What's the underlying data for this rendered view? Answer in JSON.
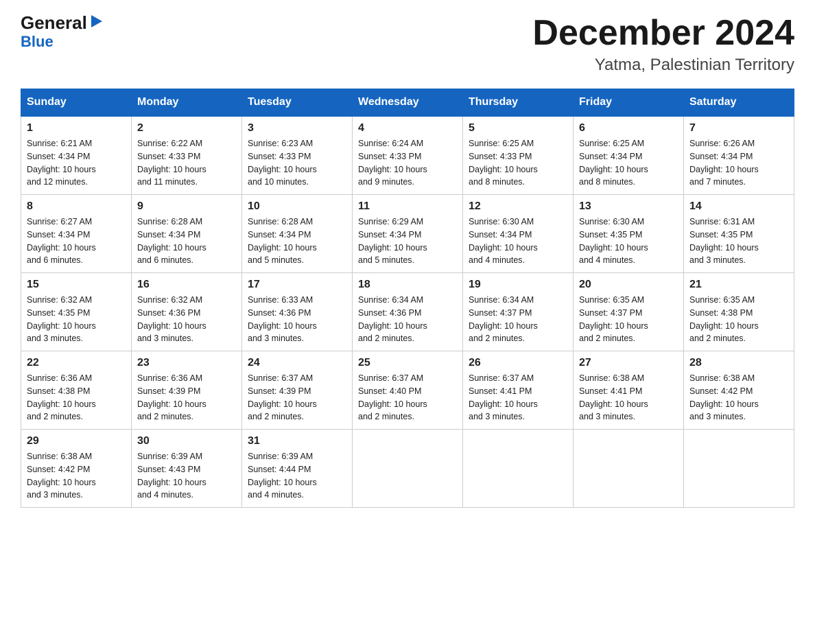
{
  "logo": {
    "general": "General",
    "blue": "Blue",
    "triangle": "▶"
  },
  "title": "December 2024",
  "subtitle": "Yatma, Palestinian Territory",
  "headers": [
    "Sunday",
    "Monday",
    "Tuesday",
    "Wednesday",
    "Thursday",
    "Friday",
    "Saturday"
  ],
  "weeks": [
    [
      {
        "day": "1",
        "sunrise": "6:21 AM",
        "sunset": "4:34 PM",
        "daylight": "10 hours and 12 minutes."
      },
      {
        "day": "2",
        "sunrise": "6:22 AM",
        "sunset": "4:33 PM",
        "daylight": "10 hours and 11 minutes."
      },
      {
        "day": "3",
        "sunrise": "6:23 AM",
        "sunset": "4:33 PM",
        "daylight": "10 hours and 10 minutes."
      },
      {
        "day": "4",
        "sunrise": "6:24 AM",
        "sunset": "4:33 PM",
        "daylight": "10 hours and 9 minutes."
      },
      {
        "day": "5",
        "sunrise": "6:25 AM",
        "sunset": "4:33 PM",
        "daylight": "10 hours and 8 minutes."
      },
      {
        "day": "6",
        "sunrise": "6:25 AM",
        "sunset": "4:34 PM",
        "daylight": "10 hours and 8 minutes."
      },
      {
        "day": "7",
        "sunrise": "6:26 AM",
        "sunset": "4:34 PM",
        "daylight": "10 hours and 7 minutes."
      }
    ],
    [
      {
        "day": "8",
        "sunrise": "6:27 AM",
        "sunset": "4:34 PM",
        "daylight": "10 hours and 6 minutes."
      },
      {
        "day": "9",
        "sunrise": "6:28 AM",
        "sunset": "4:34 PM",
        "daylight": "10 hours and 6 minutes."
      },
      {
        "day": "10",
        "sunrise": "6:28 AM",
        "sunset": "4:34 PM",
        "daylight": "10 hours and 5 minutes."
      },
      {
        "day": "11",
        "sunrise": "6:29 AM",
        "sunset": "4:34 PM",
        "daylight": "10 hours and 5 minutes."
      },
      {
        "day": "12",
        "sunrise": "6:30 AM",
        "sunset": "4:34 PM",
        "daylight": "10 hours and 4 minutes."
      },
      {
        "day": "13",
        "sunrise": "6:30 AM",
        "sunset": "4:35 PM",
        "daylight": "10 hours and 4 minutes."
      },
      {
        "day": "14",
        "sunrise": "6:31 AM",
        "sunset": "4:35 PM",
        "daylight": "10 hours and 3 minutes."
      }
    ],
    [
      {
        "day": "15",
        "sunrise": "6:32 AM",
        "sunset": "4:35 PM",
        "daylight": "10 hours and 3 minutes."
      },
      {
        "day": "16",
        "sunrise": "6:32 AM",
        "sunset": "4:36 PM",
        "daylight": "10 hours and 3 minutes."
      },
      {
        "day": "17",
        "sunrise": "6:33 AM",
        "sunset": "4:36 PM",
        "daylight": "10 hours and 3 minutes."
      },
      {
        "day": "18",
        "sunrise": "6:34 AM",
        "sunset": "4:36 PM",
        "daylight": "10 hours and 2 minutes."
      },
      {
        "day": "19",
        "sunrise": "6:34 AM",
        "sunset": "4:37 PM",
        "daylight": "10 hours and 2 minutes."
      },
      {
        "day": "20",
        "sunrise": "6:35 AM",
        "sunset": "4:37 PM",
        "daylight": "10 hours and 2 minutes."
      },
      {
        "day": "21",
        "sunrise": "6:35 AM",
        "sunset": "4:38 PM",
        "daylight": "10 hours and 2 minutes."
      }
    ],
    [
      {
        "day": "22",
        "sunrise": "6:36 AM",
        "sunset": "4:38 PM",
        "daylight": "10 hours and 2 minutes."
      },
      {
        "day": "23",
        "sunrise": "6:36 AM",
        "sunset": "4:39 PM",
        "daylight": "10 hours and 2 minutes."
      },
      {
        "day": "24",
        "sunrise": "6:37 AM",
        "sunset": "4:39 PM",
        "daylight": "10 hours and 2 minutes."
      },
      {
        "day": "25",
        "sunrise": "6:37 AM",
        "sunset": "4:40 PM",
        "daylight": "10 hours and 2 minutes."
      },
      {
        "day": "26",
        "sunrise": "6:37 AM",
        "sunset": "4:41 PM",
        "daylight": "10 hours and 3 minutes."
      },
      {
        "day": "27",
        "sunrise": "6:38 AM",
        "sunset": "4:41 PM",
        "daylight": "10 hours and 3 minutes."
      },
      {
        "day": "28",
        "sunrise": "6:38 AM",
        "sunset": "4:42 PM",
        "daylight": "10 hours and 3 minutes."
      }
    ],
    [
      {
        "day": "29",
        "sunrise": "6:38 AM",
        "sunset": "4:42 PM",
        "daylight": "10 hours and 3 minutes."
      },
      {
        "day": "30",
        "sunrise": "6:39 AM",
        "sunset": "4:43 PM",
        "daylight": "10 hours and 4 minutes."
      },
      {
        "day": "31",
        "sunrise": "6:39 AM",
        "sunset": "4:44 PM",
        "daylight": "10 hours and 4 minutes."
      },
      null,
      null,
      null,
      null
    ]
  ],
  "labels": {
    "sunrise": "Sunrise:",
    "sunset": "Sunset:",
    "daylight": "Daylight:"
  }
}
